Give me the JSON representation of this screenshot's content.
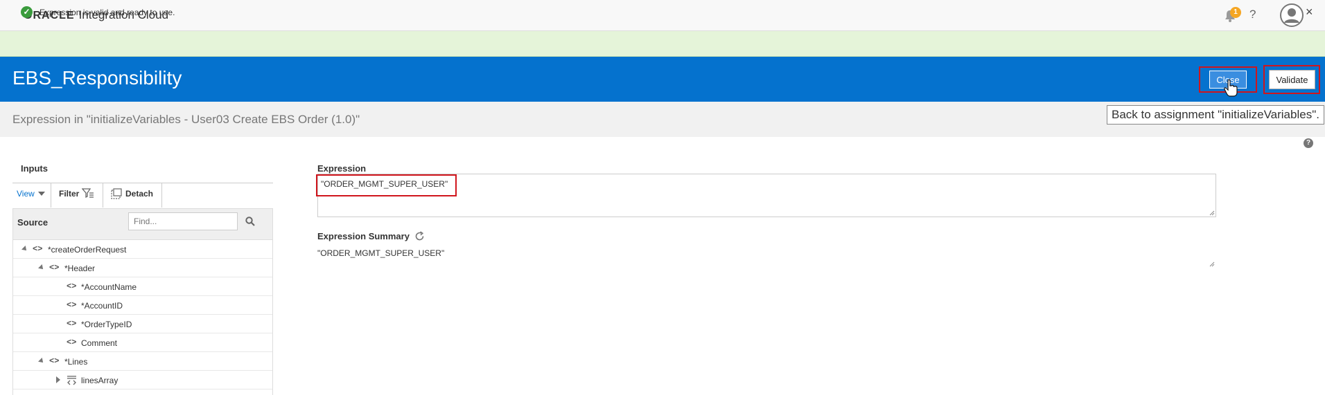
{
  "app": {
    "logo_brand": "ORACLE",
    "product": "Integration Cloud",
    "notifications_count": "1",
    "help_glyph": "?"
  },
  "banner": {
    "message": "Expression is valid and ready to use.",
    "close_glyph": "×",
    "check_glyph": "✓",
    "status_color": "#3a9b3c"
  },
  "header": {
    "title": "EBS_Responsibility",
    "close_label": "Close",
    "validate_label": "Validate",
    "tooltip": "Back to assignment \"initializeVariables\".",
    "accent_color": "#0572ce",
    "highlight_color": "#d0151c"
  },
  "subtitle": "Expression in \"initializeVariables - User03 Create EBS Order (1.0)\"",
  "help_badge": "?",
  "inputs": {
    "label": "Inputs",
    "toolbar": {
      "view": "View",
      "filter": "Filter",
      "detach": "Detach"
    },
    "source_label": "Source",
    "find_placeholder": "Find...",
    "tree": [
      {
        "label": "*createOrderRequest",
        "expander": "expanded",
        "icon": "element-tag-icon"
      },
      {
        "label": "*Header",
        "expander": "expanded",
        "icon": "element-tag-icon"
      },
      {
        "label": "*AccountName",
        "expander": "none",
        "icon": "element-tag-icon"
      },
      {
        "label": "*AccountID",
        "expander": "none",
        "icon": "element-tag-icon"
      },
      {
        "label": "*OrderTypeID",
        "expander": "none",
        "icon": "element-tag-icon"
      },
      {
        "label": "Comment",
        "expander": "none",
        "icon": "element-tag-icon"
      },
      {
        "label": "*Lines",
        "expander": "expanded",
        "icon": "element-tag-icon"
      },
      {
        "label": "linesArray",
        "expander": "collapsed",
        "icon": "repeating-element-icon"
      }
    ]
  },
  "expression": {
    "label": "Expression",
    "value": "\"ORDER_MGMT_SUPER_USER\"",
    "summary_label": "Expression Summary",
    "summary_value": "\"ORDER_MGMT_SUPER_USER\""
  }
}
